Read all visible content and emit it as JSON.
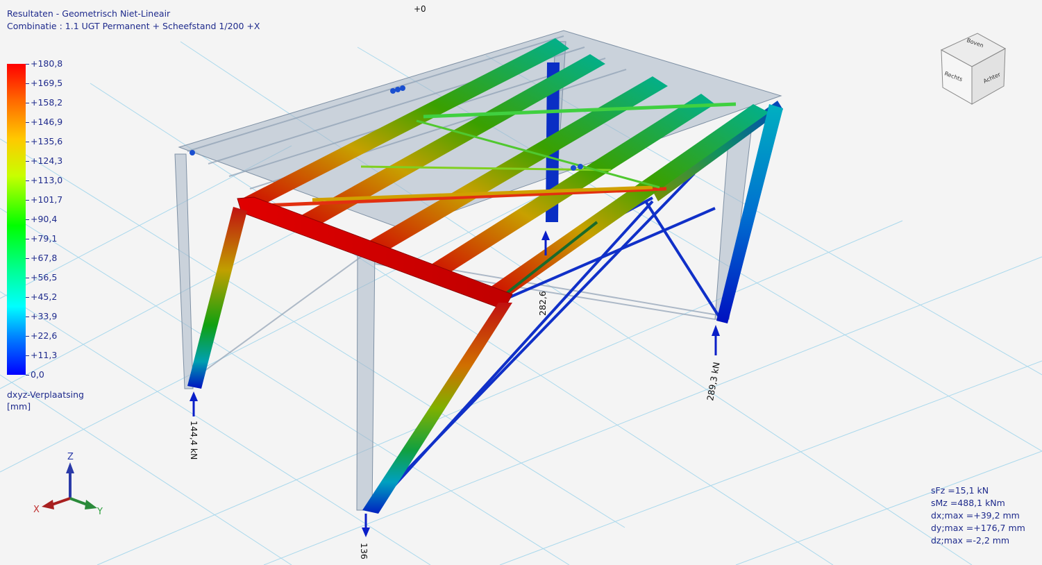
{
  "header": {
    "title": "Resultaten - Geometrisch Niet-Lineair",
    "combination": "Combinatie : 1.1 UGT  Permanent + Scheefstand 1/200 +X"
  },
  "viewport": {
    "top_marker": "+0"
  },
  "legend": {
    "labels": [
      "+180,8",
      "+169,5",
      "+158,2",
      "+146,9",
      "+135,6",
      "+124,3",
      "+113,0",
      "+101,7",
      "+90,4",
      "+79,1",
      "+67,8",
      "+56,5",
      "+45,2",
      "+33,9",
      "+22,6",
      "+11,3",
      "0,0"
    ],
    "quantity": "dxyz-Verplaatsing",
    "unit": "[mm]",
    "colors": [
      "#ff0000",
      "#ff8000",
      "#ffff00",
      "#00ff00",
      "#00ffff",
      "#0000ff"
    ]
  },
  "reactions": {
    "r1": "144,4 kN",
    "r2": "136",
    "r3": "282,6",
    "r4": "289,3 kN"
  },
  "axes": {
    "z": "Z",
    "x": "X",
    "y": "Y"
  },
  "viewcube": {
    "top": "Boven",
    "left": "Rechts",
    "right": "Achter"
  },
  "summary": [
    "sFz =15,1 kN",
    "sMz =488,1 kNm",
    "dx;max =+39,2 mm",
    "dy;max =+176,7 mm",
    "dz;max =-2,2 mm"
  ]
}
